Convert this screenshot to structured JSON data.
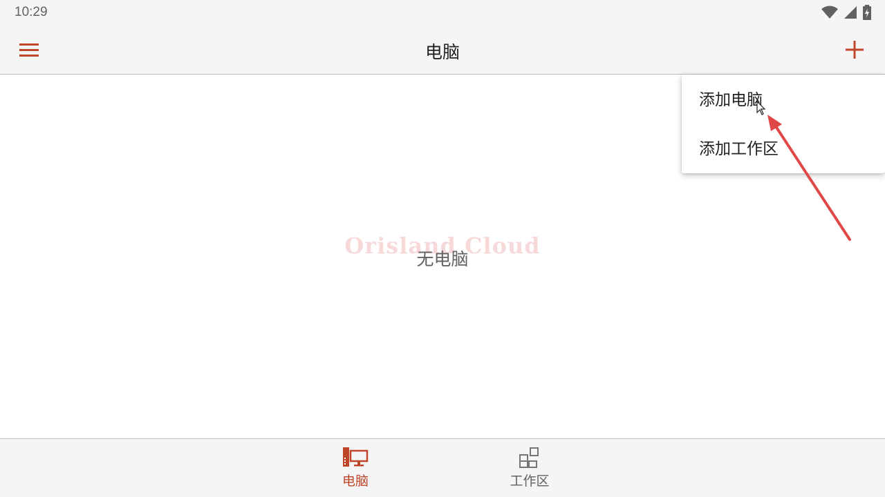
{
  "status_bar": {
    "time": "10:29",
    "icons": [
      "wifi-icon",
      "cellular-signal-icon",
      "battery-charging-icon"
    ]
  },
  "app_bar": {
    "title": "电脑",
    "menu_icon": "hamburger-menu-icon",
    "add_icon": "plus-icon"
  },
  "main": {
    "empty_message": "无电脑",
    "watermark": "Orisland Cloud"
  },
  "dropdown_menu": {
    "items": [
      {
        "label": "添加电脑"
      },
      {
        "label": "添加工作区"
      }
    ]
  },
  "bottom_nav": {
    "items": [
      {
        "label": "电脑",
        "icon": "computer-icon",
        "selected": true
      },
      {
        "label": "工作区",
        "icon": "workspace-grid-icon",
        "selected": false
      }
    ]
  },
  "colors": {
    "accent": "#c0462a",
    "annotation_arrow": "#e04848",
    "bar_background": "#f5f5f5",
    "text_primary": "#212121",
    "text_secondary": "#616161"
  }
}
